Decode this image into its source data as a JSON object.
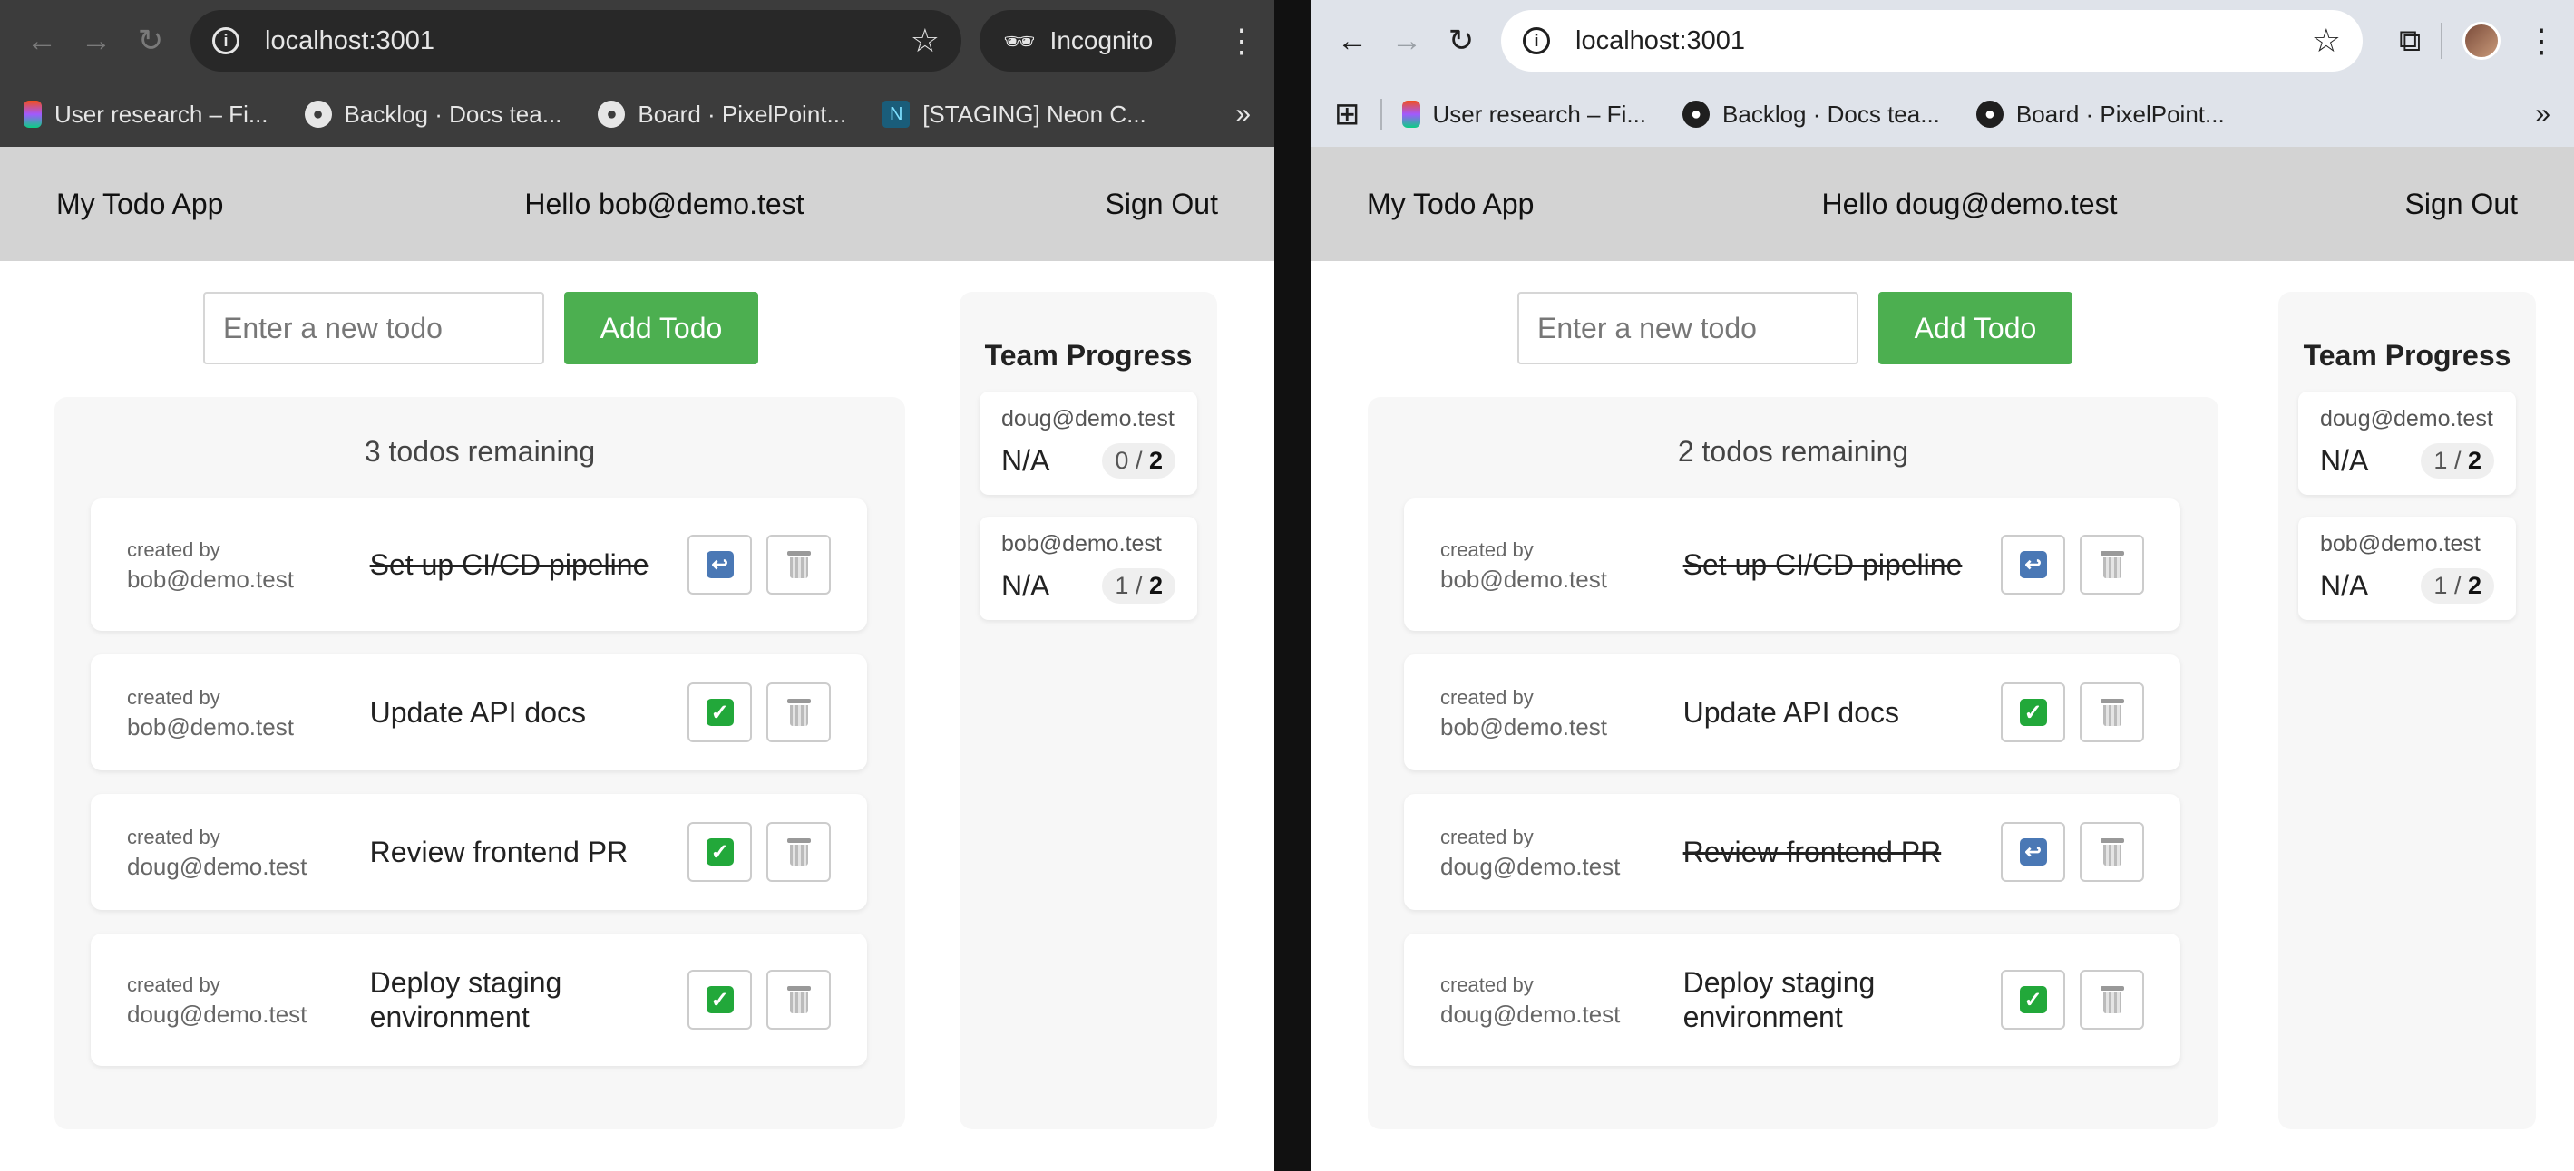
{
  "left": {
    "browser": {
      "url": "localhost:3001",
      "incognito_label": "Incognito",
      "bookmarks": [
        "User research – Fi...",
        "Backlog · Docs tea...",
        "Board · PixelPoint...",
        "[STAGING] Neon C..."
      ]
    },
    "app": {
      "title": "My Todo App",
      "greeting": "Hello bob@demo.test",
      "sign_out": "Sign Out",
      "input_placeholder": "Enter a new todo",
      "add_button": "Add Todo",
      "remaining": "3 todos remaining",
      "todos": [
        {
          "created_by_label": "created by",
          "creator": "bob@demo.test",
          "text": "Set up CI/CD pipeline",
          "done": true
        },
        {
          "created_by_label": "created by",
          "creator": "bob@demo.test",
          "text": "Update API docs",
          "done": false
        },
        {
          "created_by_label": "created by",
          "creator": "doug@demo.test",
          "text": "Review frontend PR",
          "done": false
        },
        {
          "created_by_label": "created by",
          "creator": "doug@demo.test",
          "text": "Deploy staging environment",
          "done": false
        }
      ],
      "team_title": "Team Progress",
      "team": [
        {
          "email": "doug@demo.test",
          "status": "N/A",
          "completed": "0",
          "total": "2"
        },
        {
          "email": "bob@demo.test",
          "status": "N/A",
          "completed": "1",
          "total": "2"
        }
      ]
    }
  },
  "right": {
    "browser": {
      "url": "localhost:3001",
      "bookmarks": [
        "User research – Fi...",
        "Backlog · Docs tea...",
        "Board · PixelPoint..."
      ]
    },
    "app": {
      "title": "My Todo App",
      "greeting": "Hello doug@demo.test",
      "sign_out": "Sign Out",
      "input_placeholder": "Enter a new todo",
      "add_button": "Add Todo",
      "remaining": "2 todos remaining",
      "todos": [
        {
          "created_by_label": "created by",
          "creator": "bob@demo.test",
          "text": "Set up CI/CD pipeline",
          "done": true
        },
        {
          "created_by_label": "created by",
          "creator": "bob@demo.test",
          "text": "Update API docs",
          "done": false
        },
        {
          "created_by_label": "created by",
          "creator": "doug@demo.test",
          "text": "Review frontend PR",
          "done": true
        },
        {
          "created_by_label": "created by",
          "creator": "doug@demo.test",
          "text": "Deploy staging environment",
          "done": false
        }
      ],
      "team_title": "Team Progress",
      "team": [
        {
          "email": "doug@demo.test",
          "status": "N/A",
          "completed": "1",
          "total": "2"
        },
        {
          "email": "bob@demo.test",
          "status": "N/A",
          "completed": "1",
          "total": "2"
        }
      ]
    }
  },
  "colors": {
    "accent_green": "#4caf50",
    "header_bg": "#d3d3d3",
    "incognito_chrome": "#3c3c3c",
    "light_chrome": "#dfe3ea"
  },
  "icons": {
    "done_toggle": "check-mark-button-icon",
    "undo_toggle": "undo-arrow-icon",
    "delete": "wastebasket-icon"
  }
}
